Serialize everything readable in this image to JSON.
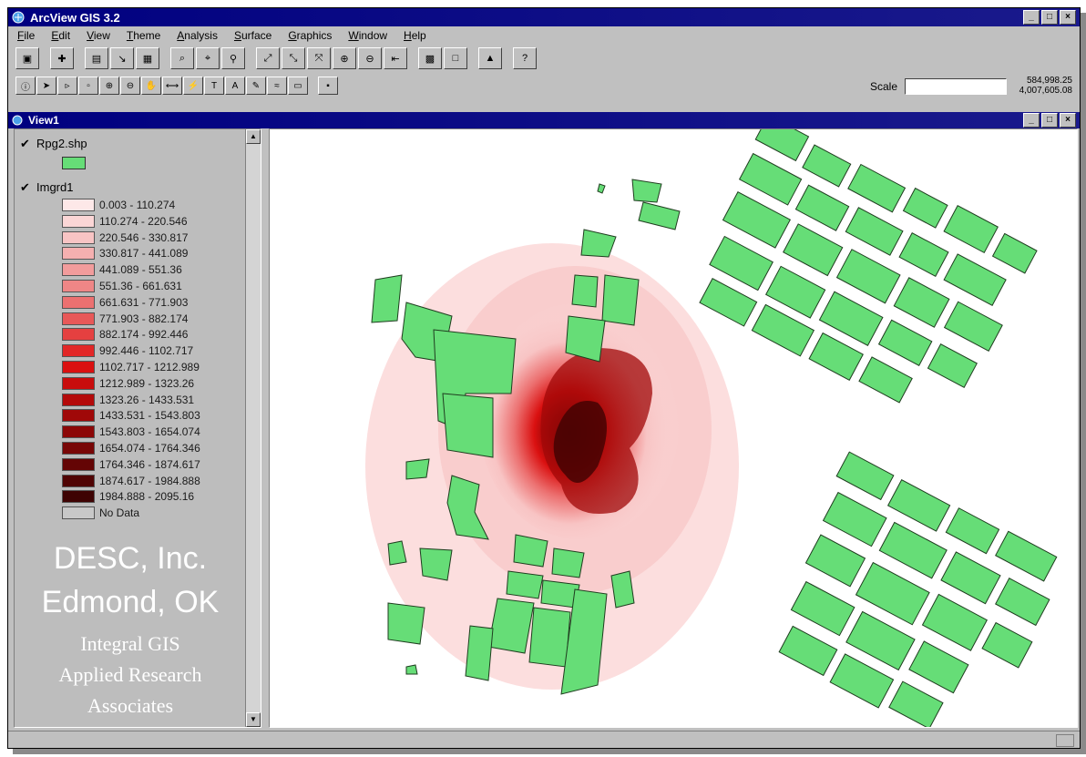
{
  "app": {
    "title": "ArcView GIS 3.2"
  },
  "menu": [
    "File",
    "Edit",
    "View",
    "Theme",
    "Analysis",
    "Surface",
    "Graphics",
    "Window",
    "Help"
  ],
  "scale": {
    "label": "Scale",
    "value": "",
    "coord_x": "584,998.25",
    "coord_y": "4,007,605.08"
  },
  "view": {
    "title": "View1"
  },
  "toc": {
    "theme1": {
      "name": "Rpg2.shp",
      "swatch": "#66dd77"
    },
    "theme2": {
      "name": "Imgrd1",
      "classes": [
        {
          "label": "0.003 - 110.274",
          "color": "#fde8e8"
        },
        {
          "label": "110.274 - 220.546",
          "color": "#fbd6d6"
        },
        {
          "label": "220.546 - 330.817",
          "color": "#f8c4c4"
        },
        {
          "label": "330.817 - 441.089",
          "color": "#f5b0b0"
        },
        {
          "label": "441.089 - 551.36",
          "color": "#f29c9c"
        },
        {
          "label": "551.36 - 661.631",
          "color": "#ef8686"
        },
        {
          "label": "661.631 - 771.903",
          "color": "#ec7070"
        },
        {
          "label": "771.903 - 882.174",
          "color": "#e85858"
        },
        {
          "label": "882.174 - 992.446",
          "color": "#e54040"
        },
        {
          "label": "992.446 - 1102.717",
          "color": "#e22626"
        },
        {
          "label": "1102.717 - 1212.989",
          "color": "#da1010"
        },
        {
          "label": "1212.989 - 1323.26",
          "color": "#c80c0c"
        },
        {
          "label": "1323.26 - 1433.531",
          "color": "#b40a0a"
        },
        {
          "label": "1433.531 - 1543.803",
          "color": "#a00808"
        },
        {
          "label": "1543.803 - 1654.074",
          "color": "#8c0707"
        },
        {
          "label": "1654.074 - 1764.346",
          "color": "#780606"
        },
        {
          "label": "1764.346 - 1874.617",
          "color": "#640505"
        },
        {
          "label": "1874.617 - 1984.888",
          "color": "#500404"
        },
        {
          "label": "1984.888 - 2095.16",
          "color": "#3e0303"
        },
        {
          "label": "No Data",
          "color": "#c8c8c8"
        }
      ]
    }
  },
  "watermark": {
    "line1": "DESC, Inc.",
    "line2": "Edmond, OK",
    "line3": "Integral GIS",
    "line4": "Applied Research",
    "line5": "Associates"
  },
  "colors": {
    "building": "#66dd77",
    "titlebar": "#000080"
  }
}
